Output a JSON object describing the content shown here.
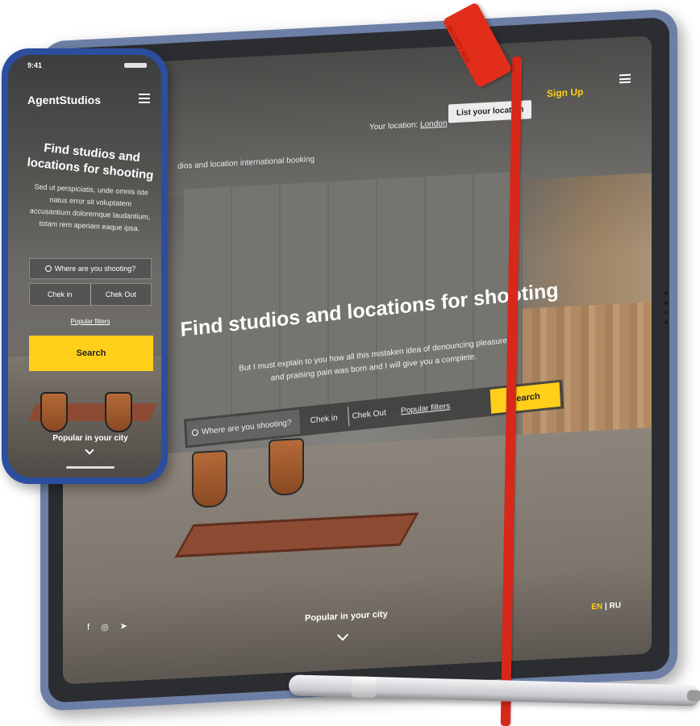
{
  "tablet": {
    "tagline": "dios and location international booking",
    "location_label": "Your location:",
    "location_value": "London",
    "list_button": "List your location",
    "signup": "Sign Up",
    "title": "Find studios and locations for shooting",
    "subtitle": "But I must explain to you how all this mistaken idea of denouncing pleasure and praising pain was born and I will give you a complete.",
    "search": {
      "where_placeholder": "Where are you shooting?",
      "check_in": "Chek in",
      "check_out": "Chek Out",
      "filters": "Popular filters",
      "button": "Search"
    },
    "popular": "Popular in your city",
    "lang": {
      "active": "EN",
      "separator": "|",
      "other": "RU"
    },
    "social_icons": [
      "facebook-icon",
      "instagram-icon",
      "telegram-icon"
    ]
  },
  "phone": {
    "time": "9:41",
    "logo": "AgentStudios",
    "title": "Find studios and locations for shooting",
    "subtitle": "Sed ut perspiciatis, unde omnis iste natus error sit voluptatem accusantium doloremque laudantium, totam rem aperiam eaque ipsa.",
    "where_placeholder": "Where are you shooting?",
    "check_in": "Chek in",
    "check_out": "Chek Out",
    "filters": "Popular filters",
    "search_button": "Search",
    "popular": "Popular in your city"
  },
  "tag": {
    "text": "SECURITY SEAL"
  },
  "colors": {
    "accent": "#ffcf1a",
    "device_frame": "#2c4e9f",
    "tag_red": "#e22d1b"
  }
}
